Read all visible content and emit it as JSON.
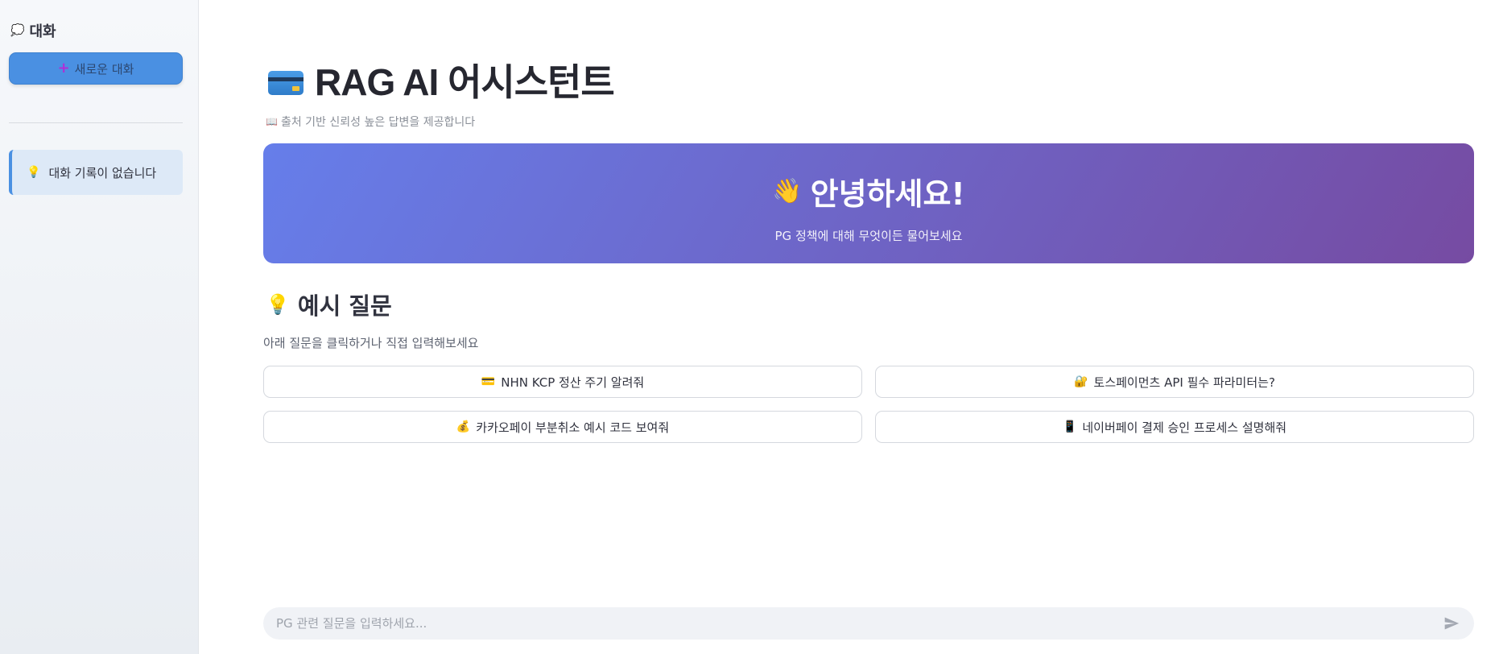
{
  "sidebar": {
    "title_icon": "💭",
    "title": "대화",
    "new_chat_icon": "➕",
    "new_chat_label": "새로운 대화",
    "history_empty_icon": "💡",
    "history_empty_text": "대화 기록이 없습니다"
  },
  "header": {
    "title": "RAG AI 어시스턴트",
    "subtitle_icon": "📖",
    "subtitle": "출처 기반 신뢰성 높은 답변을 제공합니다"
  },
  "hero": {
    "icon": "👋",
    "title": "안녕하세요!",
    "subtitle": "PG 정책에 대해 무엇이든 물어보세요"
  },
  "examples": {
    "heading_icon": "💡",
    "heading": "예시 질문",
    "description": "아래 질문을 클릭하거나 직접 입력해보세요",
    "items": [
      {
        "icon": "💳",
        "label": "NHN KCP 정산 주기 알려줘"
      },
      {
        "icon": "🔐",
        "label": "토스페이먼츠 API 필수 파라미터는?"
      },
      {
        "icon": "💰",
        "label": "카카오페이 부분취소 예시 코드 보여줘"
      },
      {
        "icon": "📱",
        "label": "네이버페이 결제 승인 프로세스 설명해줘"
      }
    ]
  },
  "chat_input": {
    "placeholder": "PG 관련 질문을 입력하세요...",
    "value": ""
  },
  "colors": {
    "primary": "#4a90e2",
    "hero_gradient_start": "#667eea",
    "hero_gradient_end": "#764ba2"
  }
}
